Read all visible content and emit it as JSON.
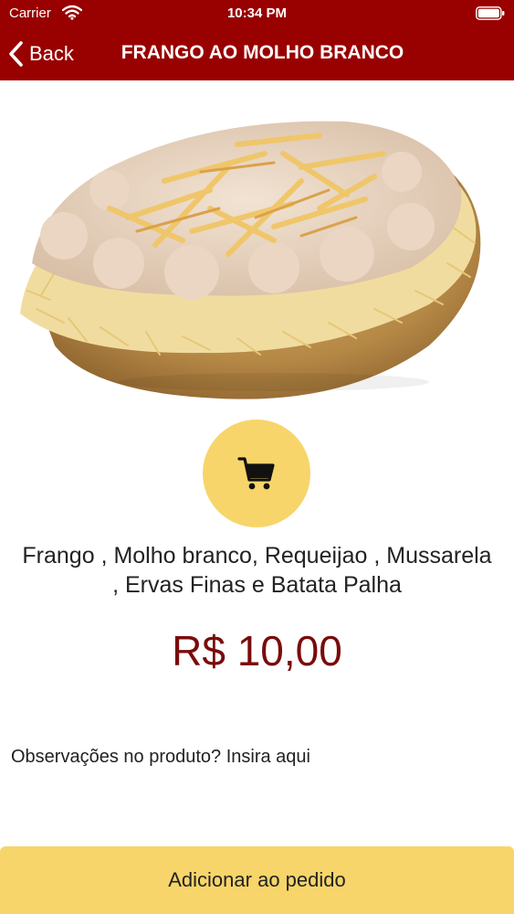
{
  "status_bar": {
    "carrier": "Carrier",
    "time": "10:34 PM",
    "wifi_icon": "wifi-icon",
    "battery_icon": "battery-icon"
  },
  "nav": {
    "back_label": "Back",
    "title": "FRANGO AO MOLHO BRANCO",
    "bar_color": "#990000"
  },
  "product": {
    "image": "baked-potato-photo",
    "cart_icon": "cart-icon",
    "description": "Frango , Molho branco, Requeijao , Mussarela , Ervas Finas e Batata Palha",
    "price": "R$ 10,00",
    "price_color": "#7a0b0b"
  },
  "notes": {
    "placeholder": "Observações no produto? Insira aqui",
    "value": ""
  },
  "actions": {
    "add_label": "Adicionar ao pedido",
    "accent_color": "#f7d56a"
  }
}
